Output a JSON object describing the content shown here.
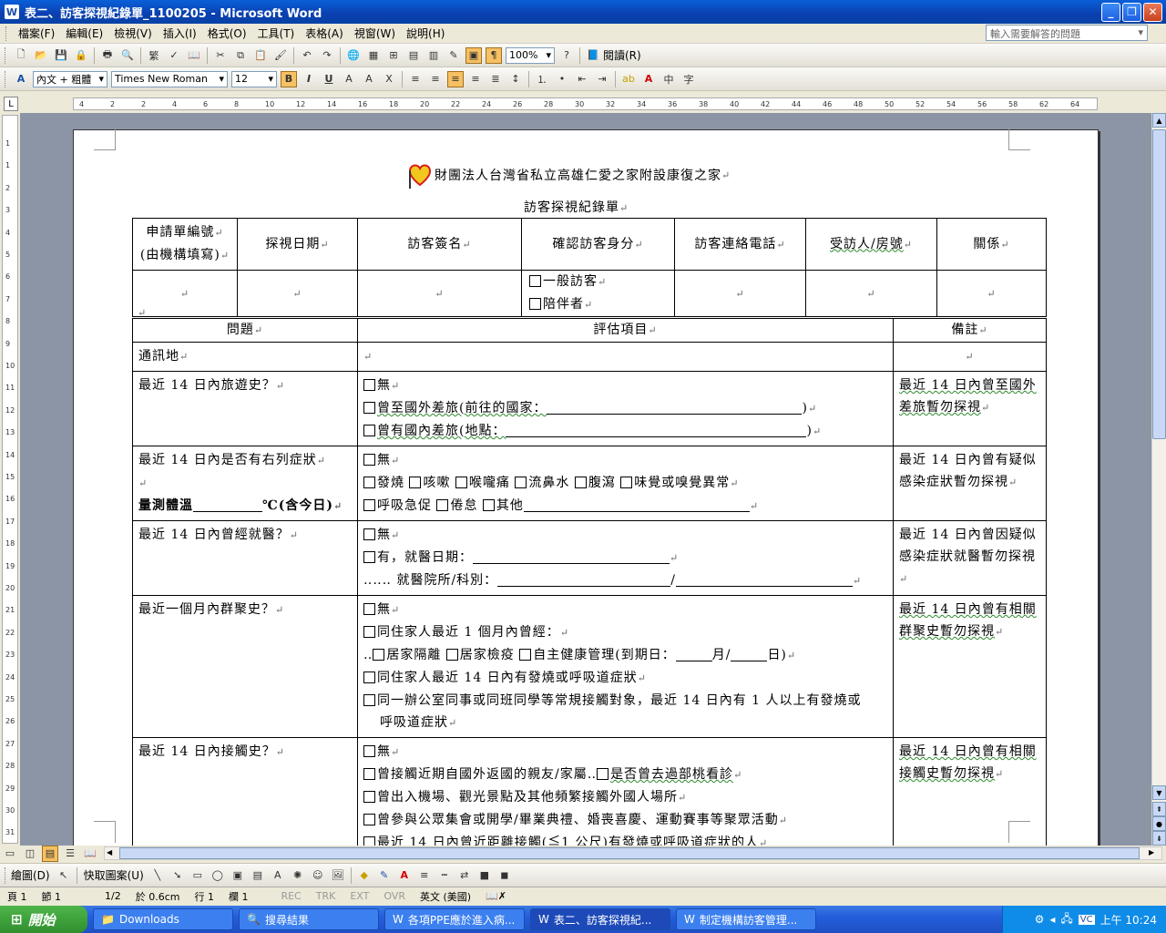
{
  "window": {
    "title": "表二、訪客探視紀錄單_1100205 - Microsoft Word"
  },
  "menu": [
    "檔案(F)",
    "編輯(E)",
    "檢視(V)",
    "插入(I)",
    "格式(O)",
    "工具(T)",
    "表格(A)",
    "視窗(W)",
    "說明(H)"
  ],
  "help_placeholder": "輸入需要解答的問題",
  "toolbar": {
    "zoom": "100%",
    "read_label": "閱讀(R)"
  },
  "formatting": {
    "style": "內文 + 粗體",
    "font": "Times New Roman",
    "size": "12"
  },
  "ruler_h": [
    "4",
    "2",
    "2",
    "4",
    "6",
    "8",
    "10",
    "12",
    "14",
    "16",
    "18",
    "20",
    "22",
    "24",
    "26",
    "28",
    "30",
    "32",
    "34",
    "36",
    "38",
    "40",
    "42",
    "44",
    "46",
    "48",
    "50",
    "52",
    "54",
    "56",
    "58",
    "62",
    "64"
  ],
  "ruler_v": [
    "1",
    "1",
    "2",
    "3",
    "4",
    "5",
    "6",
    "7",
    "8",
    "9",
    "10",
    "11",
    "12",
    "13",
    "14",
    "15",
    "16",
    "17",
    "18",
    "19",
    "20",
    "21",
    "22",
    "23",
    "24",
    "25",
    "26",
    "27",
    "28",
    "29",
    "30",
    "31"
  ],
  "doc": {
    "org": "財團法人台灣省私立高雄仁愛之家附設康復之家",
    "form_title": "訪客探視紀錄單",
    "t1_headers": [
      "申請單編號",
      "(由機構填寫)",
      "探視日期",
      "訪客簽名",
      "確認訪客身分",
      "訪客連絡電話",
      "受訪人/房號",
      "關係"
    ],
    "t1_opts": [
      "一般訪客",
      "陪伴者"
    ],
    "t2_headers": [
      "問題",
      "評估項目",
      "備註"
    ],
    "r0": {
      "q": "通訊地"
    },
    "r1": {
      "q": "最近 14 日內旅遊史？",
      "a": [
        "無",
        "曾至國外差旅(前往的國家：",
        ")",
        "曾有國內差旅(地點：",
        ")"
      ],
      "note": "最近 14 日內曾至國外差旅暫勿探視"
    },
    "r2": {
      "q": "最近 14 日內是否有右列症狀",
      "temp": "量測體溫",
      "temp_unit": "℃(含今日)",
      "a": [
        "無",
        "發燒",
        "咳嗽",
        "喉嚨痛",
        "流鼻水",
        "腹瀉",
        "味覺或嗅覺異常",
        "呼吸急促",
        "倦怠",
        "其他"
      ],
      "note": "最近 14 日內曾有疑似感染症狀暫勿探視"
    },
    "r3": {
      "q": "最近 14 日內曾經就醫？",
      "a": [
        "無",
        "有，就醫日期：",
        "‥‥‥ 就醫院所/科別：",
        "/"
      ],
      "note": "最近 14 日內曾因疑似感染症狀就醫暫勿探視"
    },
    "r4": {
      "q": "最近一個月內群聚史？",
      "a": [
        "無",
        "同住家人最近 1 個月內曾經：",
        "居家隔離",
        "居家檢疫",
        "自主健康管理(到期日：",
        "月/",
        "日)",
        "同住家人最近 14 日內有發燒或呼吸道症狀",
        "同一辦公室同事或同班同學等常規接觸對象，最近 14 日內有 1 人以上有發燒或",
        "呼吸道症狀"
      ],
      "note": "最近 14 日內曾有相關群聚史暫勿探視"
    },
    "r5": {
      "q": "最近 14 日內接觸史？",
      "a": [
        "無",
        "曾接觸近期自國外返國的親友/家屬",
        "是否曾去過部桃看診",
        "曾出入機場、觀光景點及其他頻繁接觸外國人場所",
        "曾參與公眾集會或開學/畢業典禮、婚喪喜慶、運動賽事等聚眾活動",
        "最近 14 日內曾近距離接觸(≦1 公尺)有發燒或呼吸道症狀的人"
      ],
      "note": "最近 14 日內曾有相關接觸史暫勿探視"
    }
  },
  "drawbar": {
    "draw": "繪圖(D)",
    "autoshape": "快取圖案(U)"
  },
  "status": {
    "page": "頁 1",
    "section": "節 1",
    "pages": "1/2",
    "at": "於 0.6cm",
    "line": "行 1",
    "col": "欄 1",
    "rec": "REC",
    "trk": "TRK",
    "ext": "EXT",
    "ovr": "OVR",
    "lang": "英文 (美國)"
  },
  "taskbar": {
    "start": "開始",
    "tasks": [
      "Downloads",
      "搜尋結果",
      "各項PPE應於進入病...",
      "表二、訪客探視紀...",
      "制定機構訪客管理..."
    ],
    "clock": "上午 10:24"
  },
  "colors": {
    "title_bar": "#0a5fd8",
    "taskbar": "#245edb",
    "page_bg": "#8c95a5"
  }
}
